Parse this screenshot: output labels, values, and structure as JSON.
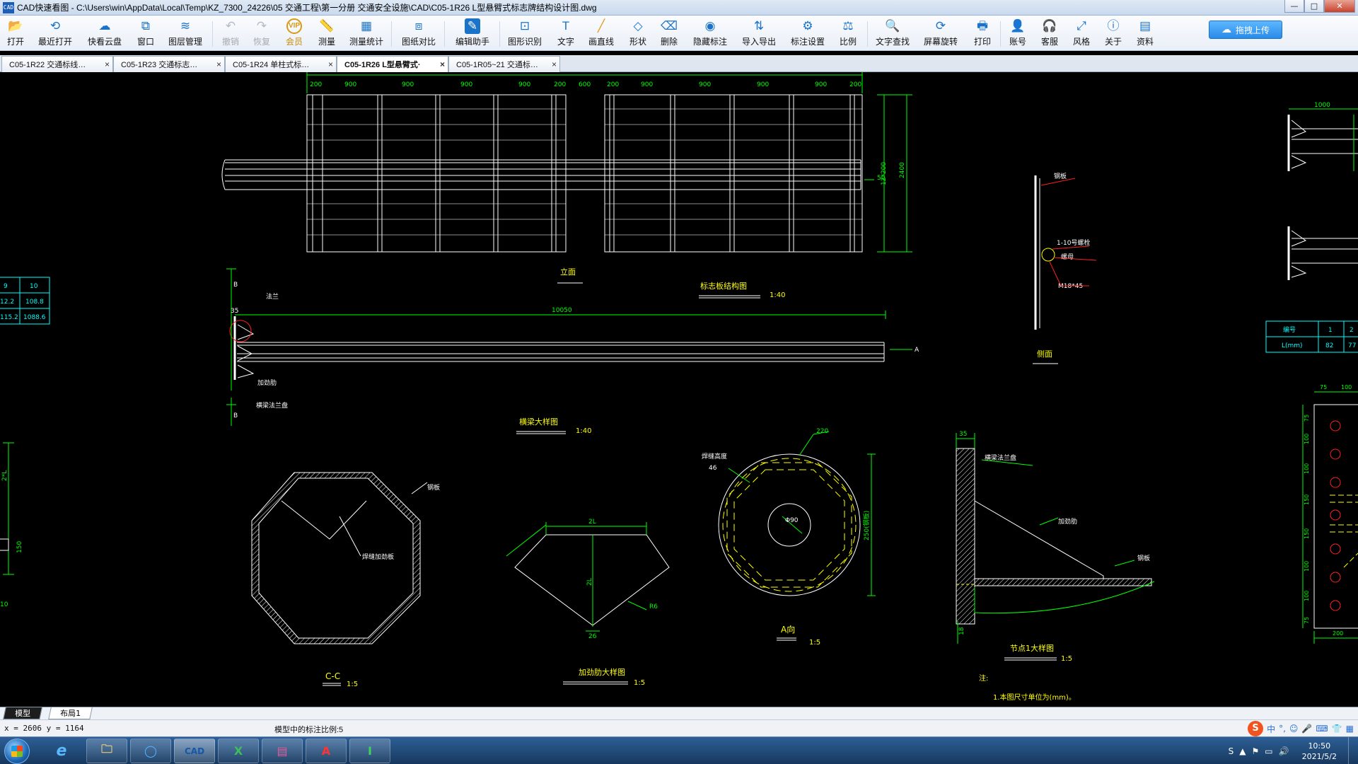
{
  "window": {
    "app_icon_text": "CAD",
    "title": "CAD快速看图 - C:\\Users\\win\\AppData\\Local\\Temp\\KZ_7300_24226\\05 交通工程\\第一分册  交通安全设施\\CAD\\C05-1R26  L型悬臂式标志牌结构设计图.dwg",
    "controls": {
      "minimize": "—",
      "maximize": "□",
      "close": "✕"
    }
  },
  "toolbar": {
    "buttons": [
      {
        "id": "open",
        "label": "打开",
        "icon": "📂"
      },
      {
        "id": "recent",
        "label": "最近打开",
        "icon": "⟲"
      },
      {
        "id": "cloud",
        "label": "快看云盘",
        "icon": "☁"
      },
      {
        "id": "window",
        "label": "窗口",
        "icon": "⧉"
      },
      {
        "id": "layers",
        "label": "图层管理",
        "icon": "≋"
      },
      {
        "id": "undo",
        "label": "撤销",
        "icon": "↶"
      },
      {
        "id": "redo",
        "label": "恢复",
        "icon": "↷"
      },
      {
        "id": "vip",
        "label": "会员",
        "icon": "VIP"
      },
      {
        "id": "measure",
        "label": "测量",
        "icon": "📏"
      },
      {
        "id": "measure_stats",
        "label": "测量统计",
        "icon": "▦"
      },
      {
        "id": "compare",
        "label": "图纸对比",
        "icon": "⧈"
      },
      {
        "id": "assistant",
        "label": "编辑助手",
        "icon": "✎"
      },
      {
        "id": "shape_recog",
        "label": "图形识别",
        "icon": "⊡"
      },
      {
        "id": "text",
        "label": "文字",
        "icon": "T"
      },
      {
        "id": "line",
        "label": "画直线",
        "icon": "╱"
      },
      {
        "id": "shape",
        "label": "形状",
        "icon": "◇"
      },
      {
        "id": "delete",
        "label": "删除",
        "icon": "⌫"
      },
      {
        "id": "hide_dim",
        "label": "隐藏标注",
        "icon": "◉"
      },
      {
        "id": "import_export",
        "label": "导入导出",
        "icon": "⇅"
      },
      {
        "id": "dim_settings",
        "label": "标注设置",
        "icon": "⚙"
      },
      {
        "id": "scale",
        "label": "比例",
        "icon": "⚖"
      },
      {
        "id": "text_search",
        "label": "文字查找",
        "icon": "🔍"
      },
      {
        "id": "rotate",
        "label": "屏幕旋转",
        "icon": "⟳"
      },
      {
        "id": "print",
        "label": "打印",
        "icon": "🖶"
      },
      {
        "id": "account",
        "label": "账号",
        "icon": "👤"
      },
      {
        "id": "service",
        "label": "客服",
        "icon": "🎧"
      },
      {
        "id": "style",
        "label": "风格",
        "icon": "⤢"
      },
      {
        "id": "about",
        "label": "关于",
        "icon": "ⓘ"
      },
      {
        "id": "resources",
        "label": "资料",
        "icon": "▤"
      }
    ],
    "upload_label": "拖拽上传",
    "upload_icon": "☁"
  },
  "tabs": [
    {
      "label": "C05-1R22  交通标线…",
      "close": "×"
    },
    {
      "label": "C05-1R23  交通标志…",
      "close": "×"
    },
    {
      "label": "C05-1R24  单柱式标…",
      "close": "×"
    },
    {
      "label": "C05-1R26  L型悬臂式·",
      "close": "×"
    },
    {
      "label": "C05-1R05~21  交通标…",
      "close": "×"
    }
  ],
  "drawing": {
    "front_dims": [
      "200",
      "900",
      "900",
      "900",
      "900",
      "200",
      "600",
      "200",
      "900",
      "900",
      "900",
      "900",
      "200"
    ],
    "height_dims": [
      "12*200",
      "2400"
    ],
    "front_label_50": "50",
    "label_elevation": "立面",
    "label_sign_struct": "标志板结构图",
    "scale_1_40": "1:40",
    "dim_10050": "10050",
    "label_A": "A",
    "label_B": "B",
    "label_35": "35",
    "label_flange": "法兰",
    "label_stiffener": "加劲肋",
    "label_bottom_flange": "横梁法兰盘",
    "label_beam_detail": "横梁大样图",
    "label_side": "侧面",
    "side_labels": [
      "钢板",
      "1-10号螺栓",
      "螺母",
      "M18*45"
    ],
    "table_left": [
      [
        "9",
        "10"
      ],
      [
        "12.2",
        "108.8"
      ],
      [
        "115.2",
        "1088.6"
      ]
    ],
    "table_right": [
      [
        "编号",
        "1",
        "2"
      ],
      [
        "L(mm)",
        "82",
        "77"
      ]
    ],
    "right_top_dim": "1000",
    "octagon_label": "钢板",
    "octagon_inner": "焊缝加劲板",
    "label_CC": "C-C",
    "scale_1_5": "1:5",
    "stiff_dims": [
      "2L",
      "2L",
      "26",
      "R6"
    ],
    "label_stiffener_detail": "加劲肋大样图",
    "circle_dims": [
      "220",
      "焊缝高度",
      "46",
      "Φ90",
      "250(钢板)"
    ],
    "label_A_view": "A向",
    "detail_dims": [
      "35",
      "18"
    ],
    "detail_labels": [
      "横梁法兰盘",
      "加劲肋",
      "钢板"
    ],
    "label_node_detail": "节点1大样图",
    "note_head": "注:",
    "note_body": "1.本图尺寸单位为(mm)。",
    "right_col_dims": [
      "75",
      "100",
      "75",
      "100",
      "100",
      "150",
      "150",
      "100",
      "100",
      "75",
      "200"
    ],
    "left_edge_dims": [
      "2*L",
      "150",
      "10"
    ]
  },
  "layout_tabs": [
    {
      "label": "模型",
      "active": true
    },
    {
      "label": "布局1",
      "active": false
    }
  ],
  "status": {
    "coords": "x = 2606  y = 1164",
    "scale_text": "模型中的标注比例:5"
  },
  "ime": {
    "logo": "S",
    "mode": "中",
    "icons": [
      "°,",
      "☺",
      "🎤",
      "⌨",
      "👕",
      "▦"
    ]
  },
  "taskbar": {
    "items": [
      {
        "name": "ie",
        "icon": "e"
      },
      {
        "name": "explorer",
        "icon": "🗀"
      },
      {
        "name": "browser",
        "icon": "◯"
      },
      {
        "name": "cad-viewer",
        "icon": "CAD"
      },
      {
        "name": "excel",
        "icon": "X"
      },
      {
        "name": "winrar",
        "icon": "▤"
      },
      {
        "name": "autocad",
        "icon": "A"
      },
      {
        "name": "tool",
        "icon": "Ⅰ"
      }
    ],
    "tray_icons": [
      "S",
      "▲",
      "⚑",
      "▭",
      "🔊"
    ],
    "time": "10:50",
    "date": "2021/5/2"
  },
  "colors": {
    "cad_white": "#ffffff",
    "cad_green": "#00ff00",
    "cad_red": "#ff2020",
    "cad_yellow": "#ffff00",
    "cad_cyan": "#00ffff",
    "accent": "#1a73c8"
  }
}
